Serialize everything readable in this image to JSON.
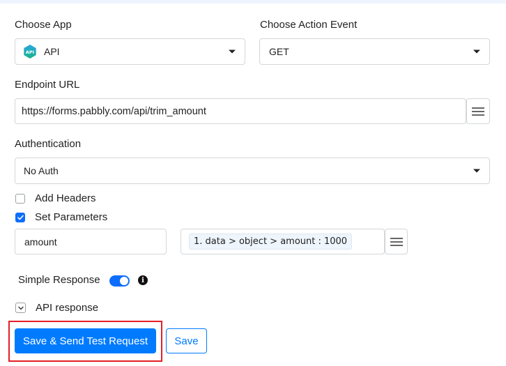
{
  "choose_app": {
    "label": "Choose App",
    "value": "API",
    "icon": "api-logo-icon"
  },
  "choose_action_event": {
    "label": "Choose Action Event",
    "value": "GET"
  },
  "endpoint_url": {
    "label": "Endpoint URL",
    "value": "https://forms.pabbly.com/api/trim_amount"
  },
  "authentication": {
    "label": "Authentication",
    "value": "No Auth"
  },
  "add_headers": {
    "label": "Add Headers",
    "checked": false
  },
  "set_parameters": {
    "label": "Set Parameters",
    "checked": true,
    "param_key": "amount",
    "param_value_token": "1. data > object > amount : 1000"
  },
  "simple_response": {
    "label": "Simple Response",
    "enabled": true
  },
  "api_response": {
    "label": "API response"
  },
  "buttons": {
    "save_and_send": "Save & Send Test Request",
    "save": "Save"
  },
  "colors": {
    "primary": "#007bff",
    "highlight": "#e41e26",
    "token_bg": "#eef5fc"
  }
}
